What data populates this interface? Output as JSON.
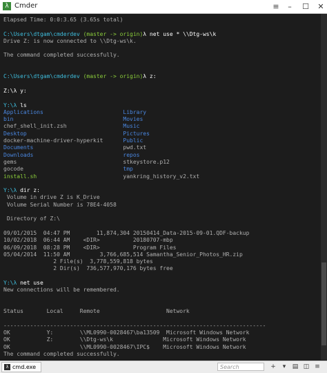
{
  "window": {
    "title": "Cmder",
    "app_icon": "λ"
  },
  "terminal": {
    "lines": [
      [
        {
          "t": "Elapsed Time: 0:0:3.65 (3.65s total)",
          "c": "dim"
        }
      ],
      [
        {
          "t": "",
          "c": ""
        }
      ],
      [
        {
          "t": "C:\\Users\\dtgam\\cmderdev",
          "c": "cyan"
        },
        {
          "t": " (master -> origin)",
          "c": "green"
        },
        {
          "t": "λ net use * \\\\Dtg-ws\\k",
          "c": "white"
        }
      ],
      [
        {
          "t": "Drive Z: is now connected to \\\\Dtg-ws\\k.",
          "c": "dim"
        }
      ],
      [
        {
          "t": "",
          "c": ""
        }
      ],
      [
        {
          "t": "The command completed successfully.",
          "c": "dim"
        }
      ],
      [
        {
          "t": "",
          "c": ""
        }
      ],
      [
        {
          "t": "",
          "c": ""
        }
      ],
      [
        {
          "t": "C:\\Users\\dtgam\\cmderdev",
          "c": "cyan"
        },
        {
          "t": " (master -> origin)",
          "c": "green"
        },
        {
          "t": "λ z:",
          "c": "white"
        }
      ],
      [
        {
          "t": "",
          "c": ""
        }
      ],
      [
        {
          "t": "Z:\\λ y:",
          "c": "white"
        }
      ],
      [
        {
          "t": "",
          "c": ""
        }
      ],
      [
        {
          "t": "Y:\\λ ",
          "c": "cyan"
        },
        {
          "t": "ls",
          "c": "white"
        }
      ],
      [
        {
          "t": "Applications                        ",
          "c": "blue"
        },
        {
          "t": "Library",
          "c": "blue"
        }
      ],
      [
        {
          "t": "bin                                 ",
          "c": "blue"
        },
        {
          "t": "Movies",
          "c": "blue"
        }
      ],
      [
        {
          "t": "chef_shell_init.zsh                 ",
          "c": "dim"
        },
        {
          "t": "Music",
          "c": "blue"
        }
      ],
      [
        {
          "t": "Desktop                             ",
          "c": "blue"
        },
        {
          "t": "Pictures",
          "c": "blue"
        }
      ],
      [
        {
          "t": "docker-machine-driver-hyperkit      ",
          "c": "dim"
        },
        {
          "t": "Public",
          "c": "blue"
        }
      ],
      [
        {
          "t": "Documents                           ",
          "c": "blue"
        },
        {
          "t": "pwd.txt",
          "c": "dim"
        }
      ],
      [
        {
          "t": "Downloads                           ",
          "c": "blue"
        },
        {
          "t": "repos",
          "c": "blue"
        }
      ],
      [
        {
          "t": "gems                                ",
          "c": "dim"
        },
        {
          "t": "stkeystore.p12",
          "c": "dim"
        }
      ],
      [
        {
          "t": "gocode                              ",
          "c": "dim"
        },
        {
          "t": "tmp",
          "c": "blue"
        }
      ],
      [
        {
          "t": "install.sh                          ",
          "c": "green"
        },
        {
          "t": "yankring_history_v2.txt",
          "c": "dim"
        }
      ],
      [
        {
          "t": "",
          "c": ""
        }
      ],
      [
        {
          "t": "Y:\\λ ",
          "c": "cyan"
        },
        {
          "t": "dir z:",
          "c": "white"
        }
      ],
      [
        {
          "t": " Volume in drive Z is K_Drive",
          "c": "dim"
        }
      ],
      [
        {
          "t": " Volume Serial Number is 78E4-4058",
          "c": "dim"
        }
      ],
      [
        {
          "t": "",
          "c": ""
        }
      ],
      [
        {
          "t": " Directory of Z:\\",
          "c": "dim"
        }
      ],
      [
        {
          "t": "",
          "c": ""
        }
      ],
      [
        {
          "t": "09/01/2015  04:47 PM        11,874,304 20150414_Data-2015-09-01.QDF-backup",
          "c": "dim"
        }
      ],
      [
        {
          "t": "10/02/2018  06:44 AM    <DIR>          20180707-mbp",
          "c": "dim"
        }
      ],
      [
        {
          "t": "06/09/2018  08:28 PM    <DIR>          Program Files",
          "c": "dim"
        }
      ],
      [
        {
          "t": "05/04/2014  11:50 AM         3,766,685,514 Samantha_Senior_Photos_HR.zip",
          "c": "dim"
        }
      ],
      [
        {
          "t": "               2 File(s)  3,778,559,818 bytes",
          "c": "dim"
        }
      ],
      [
        {
          "t": "               2 Dir(s)  736,577,970,176 bytes free",
          "c": "dim"
        }
      ],
      [
        {
          "t": "",
          "c": ""
        }
      ],
      [
        {
          "t": "Y:\\λ ",
          "c": "cyan"
        },
        {
          "t": "net use",
          "c": "white"
        }
      ],
      [
        {
          "t": "New connections will be remembered.",
          "c": "dim"
        }
      ],
      [
        {
          "t": "",
          "c": ""
        }
      ],
      [
        {
          "t": "",
          "c": ""
        }
      ],
      [
        {
          "t": "Status       Local     Remote                    Network",
          "c": "dim"
        }
      ],
      [
        {
          "t": "",
          "c": ""
        }
      ],
      [
        {
          "t": "-------------------------------------------------------------------------------",
          "c": "dim"
        }
      ],
      [
        {
          "t": "OK           Y:        \\\\ML0990-0028467\\ba13509  Microsoft Windows Network",
          "c": "dim"
        }
      ],
      [
        {
          "t": "OK           Z:        \\\\Dtg-ws\\k               Microsoft Windows Network",
          "c": "dim"
        }
      ],
      [
        {
          "t": "OK                     \\\\ML0990-0028467\\IPC$    Microsoft Windows Network",
          "c": "dim"
        }
      ],
      [
        {
          "t": "The command completed successfully.",
          "c": "dim"
        }
      ],
      [
        {
          "t": "",
          "c": ""
        }
      ],
      [
        {
          "t": "",
          "c": ""
        }
      ],
      [
        {
          "t": "Y:\\λ ",
          "c": "cyan"
        }
      ]
    ]
  },
  "statusbar": {
    "tab_label": "cmd.exe",
    "search_placeholder": "Search",
    "tools": [
      {
        "icon": "add-icon",
        "glyph": "+"
      },
      {
        "icon": "dropdown-icon",
        "glyph": "▾"
      },
      {
        "icon": "split-icon",
        "glyph": "▤"
      },
      {
        "icon": "scroll-icon",
        "glyph": "◫"
      },
      {
        "icon": "menu-icon",
        "glyph": "≡"
      }
    ]
  },
  "colors": {
    "cyan": "#3fbfdf",
    "green": "#8ccf3b",
    "blue": "#4a87e0"
  }
}
